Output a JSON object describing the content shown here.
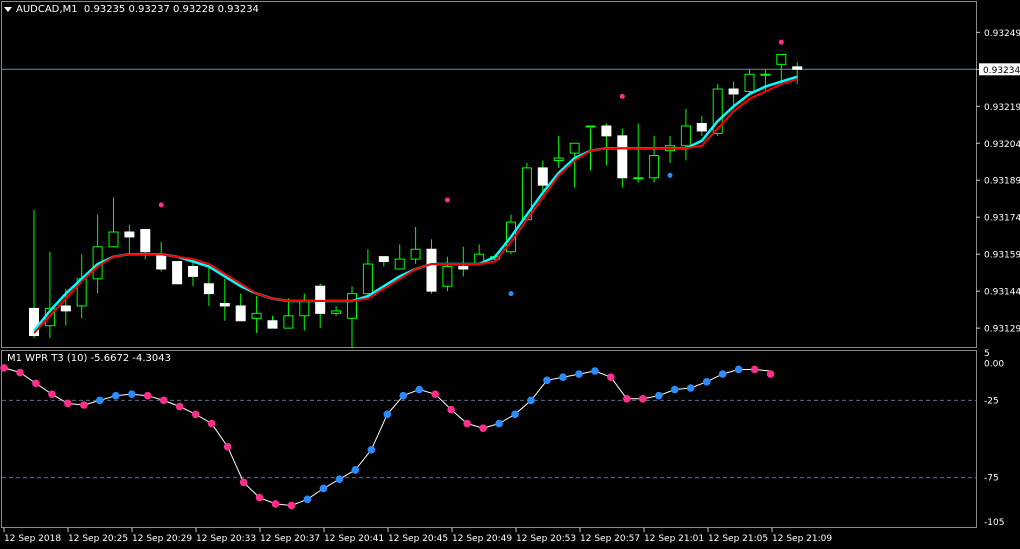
{
  "window": {
    "symbol_timeframe": "AUDCAD,M1",
    "ohlc": [
      "0.93235",
      "0.93237",
      "0.93228",
      "0.93234"
    ]
  },
  "indicator": {
    "label": "M1 WPR T3 (10)",
    "values": [
      "-5.6672",
      "-4.3043"
    ]
  },
  "colors": {
    "background": "#000000",
    "bull_candle": "#00ff00",
    "bear_candle_fill": "#ffffff",
    "ma_red": "#ff0000",
    "ma_cyan": "#00ffff",
    "dot_pink": "#ff2d8c",
    "dot_blue": "#2a8cff",
    "wpr_line": "#ffffff",
    "grid_dashed": "#5a6e8c",
    "bid_line": "#6c8ca0"
  },
  "chart_data": [
    {
      "type": "candlestick",
      "title": "AUDCAD,M1",
      "price_axis_ticks": [
        "0.93249",
        "0.93234",
        "0.93219",
        "0.93204",
        "0.93189",
        "0.93174",
        "0.93159",
        "0.93144",
        "0.93129"
      ],
      "current_price_label": "0.93234",
      "ylim": [
        0.93125,
        0.93254
      ],
      "time_axis_ticks": [
        "12 Sep 2018",
        "12 Sep 20:25",
        "12 Sep 20:29",
        "12 Sep 20:33",
        "12 Sep 20:37",
        "12 Sep 20:41",
        "12 Sep 20:45",
        "12 Sep 20:49",
        "12 Sep 20:53",
        "12 Sep 20:57",
        "12 Sep 21:01",
        "12 Sep 21:05",
        "12 Sep 21:09"
      ],
      "candles": [
        {
          "o": 0.93137,
          "h": 0.93177,
          "l": 0.93125,
          "c": 0.93126
        },
        {
          "o": 0.9313,
          "h": 0.9316,
          "l": 0.93125,
          "c": 0.93137
        },
        {
          "o": 0.93138,
          "h": 0.93145,
          "l": 0.9313,
          "c": 0.93136
        },
        {
          "o": 0.93138,
          "h": 0.93159,
          "l": 0.93133,
          "c": 0.93149
        },
        {
          "o": 0.93149,
          "h": 0.93175,
          "l": 0.93143,
          "c": 0.93162
        },
        {
          "o": 0.93162,
          "h": 0.93182,
          "l": 0.93162,
          "c": 0.93168
        },
        {
          "o": 0.93168,
          "h": 0.93171,
          "l": 0.93159,
          "c": 0.93166
        },
        {
          "o": 0.93169,
          "h": 0.93169,
          "l": 0.93157,
          "c": 0.9316
        },
        {
          "o": 0.93159,
          "h": 0.93164,
          "l": 0.93152,
          "c": 0.93153
        },
        {
          "o": 0.93156,
          "h": 0.93156,
          "l": 0.93147,
          "c": 0.93147
        },
        {
          "o": 0.93154,
          "h": 0.93157,
          "l": 0.93146,
          "c": 0.9315
        },
        {
          "o": 0.93147,
          "h": 0.93154,
          "l": 0.93138,
          "c": 0.93143
        },
        {
          "o": 0.93139,
          "h": 0.93149,
          "l": 0.93132,
          "c": 0.93138
        },
        {
          "o": 0.93138,
          "h": 0.93143,
          "l": 0.93132,
          "c": 0.93132
        },
        {
          "o": 0.93133,
          "h": 0.93142,
          "l": 0.93127,
          "c": 0.93135
        },
        {
          "o": 0.93132,
          "h": 0.93134,
          "l": 0.93129,
          "c": 0.93129
        },
        {
          "o": 0.93129,
          "h": 0.93141,
          "l": 0.93129,
          "c": 0.93134
        },
        {
          "o": 0.93134,
          "h": 0.93143,
          "l": 0.93128,
          "c": 0.9314
        },
        {
          "o": 0.93146,
          "h": 0.93147,
          "l": 0.93129,
          "c": 0.93135
        },
        {
          "o": 0.93135,
          "h": 0.93138,
          "l": 0.93134,
          "c": 0.93136
        },
        {
          "o": 0.93133,
          "h": 0.93146,
          "l": 0.93121,
          "c": 0.93143
        },
        {
          "o": 0.93143,
          "h": 0.93161,
          "l": 0.93141,
          "c": 0.93155
        },
        {
          "o": 0.93158,
          "h": 0.93158,
          "l": 0.93154,
          "c": 0.93156
        },
        {
          "o": 0.93153,
          "h": 0.93163,
          "l": 0.93153,
          "c": 0.93157
        },
        {
          "o": 0.93157,
          "h": 0.9317,
          "l": 0.93155,
          "c": 0.93161
        },
        {
          "o": 0.93161,
          "h": 0.93165,
          "l": 0.93143,
          "c": 0.93144
        },
        {
          "o": 0.93146,
          "h": 0.93158,
          "l": 0.93144,
          "c": 0.93154
        },
        {
          "o": 0.93154,
          "h": 0.93162,
          "l": 0.9315,
          "c": 0.93153
        },
        {
          "o": 0.93155,
          "h": 0.93163,
          "l": 0.93155,
          "c": 0.93159
        },
        {
          "o": 0.93157,
          "h": 0.93159,
          "l": 0.93156,
          "c": 0.93158
        },
        {
          "o": 0.9316,
          "h": 0.93175,
          "l": 0.93159,
          "c": 0.93172
        },
        {
          "o": 0.93173,
          "h": 0.93196,
          "l": 0.93173,
          "c": 0.93194
        },
        {
          "o": 0.93194,
          "h": 0.93197,
          "l": 0.93183,
          "c": 0.93187
        },
        {
          "o": 0.93197,
          "h": 0.93207,
          "l": 0.93194,
          "c": 0.93198
        },
        {
          "o": 0.932,
          "h": 0.93203,
          "l": 0.93186,
          "c": 0.93204
        },
        {
          "o": 0.93211,
          "h": 0.9321,
          "l": 0.93193,
          "c": 0.93211
        },
        {
          "o": 0.93211,
          "h": 0.93212,
          "l": 0.93195,
          "c": 0.93207
        },
        {
          "o": 0.93207,
          "h": 0.9321,
          "l": 0.93186,
          "c": 0.9319
        },
        {
          "o": 0.9319,
          "h": 0.93212,
          "l": 0.93188,
          "c": 0.9319
        },
        {
          "o": 0.9319,
          "h": 0.93207,
          "l": 0.93188,
          "c": 0.93199
        },
        {
          "o": 0.93201,
          "h": 0.93207,
          "l": 0.93196,
          "c": 0.93203
        },
        {
          "o": 0.93203,
          "h": 0.93218,
          "l": 0.93197,
          "c": 0.93211
        },
        {
          "o": 0.93212,
          "h": 0.93215,
          "l": 0.93207,
          "c": 0.93209
        },
        {
          "o": 0.93208,
          "h": 0.93228,
          "l": 0.93207,
          "c": 0.93226
        },
        {
          "o": 0.93226,
          "h": 0.93229,
          "l": 0.93218,
          "c": 0.93224
        },
        {
          "o": 0.93225,
          "h": 0.93234,
          "l": 0.93224,
          "c": 0.93232
        },
        {
          "o": 0.93232,
          "h": 0.93234,
          "l": 0.93225,
          "c": 0.93232
        },
        {
          "o": 0.93236,
          "h": 0.9324,
          "l": 0.93228,
          "c": 0.9324
        },
        {
          "o": 0.93235,
          "h": 0.93237,
          "l": 0.93228,
          "c": 0.93234
        }
      ],
      "ma_red": [
        0.93127,
        0.93134,
        0.93141,
        0.93148,
        0.93154,
        0.93158,
        0.93159,
        0.93159,
        0.93159,
        0.93158,
        0.93157,
        0.93155,
        0.93151,
        0.93147,
        0.93143,
        0.93141,
        0.9314,
        0.9314,
        0.9314,
        0.9314,
        0.9314,
        0.93141,
        0.93145,
        0.93149,
        0.93153,
        0.93155,
        0.93155,
        0.93155,
        0.93155,
        0.93156,
        0.93164,
        0.93173,
        0.93182,
        0.93191,
        0.93197,
        0.93201,
        0.93202,
        0.93202,
        0.93202,
        0.93202,
        0.93202,
        0.93202,
        0.93203,
        0.9321,
        0.93217,
        0.93222,
        0.93225,
        0.93228,
        0.9323
      ],
      "ma_cyan": [
        0.93128,
        0.93136,
        0.93143,
        0.93149,
        0.93155,
        0.93158,
        0.93159,
        0.93159,
        0.93159,
        0.93158,
        0.93156,
        0.93154,
        0.9315,
        0.93146,
        0.93143,
        0.93141,
        0.9314,
        0.9314,
        0.9314,
        0.9314,
        0.9314,
        0.93142,
        0.93146,
        0.9315,
        0.93153,
        0.93155,
        0.93155,
        0.93155,
        0.93155,
        0.93158,
        0.93166,
        0.93175,
        0.93184,
        0.93192,
        0.93198,
        0.93201,
        0.93202,
        0.93202,
        0.93202,
        0.93202,
        0.93202,
        0.93202,
        0.93205,
        0.93213,
        0.93219,
        0.93224,
        0.93227,
        0.93229,
        0.93231
      ],
      "signal_dots": [
        {
          "i": 8,
          "price": 0.93179,
          "color": "pink"
        },
        {
          "i": 26,
          "price": 0.93181,
          "color": "pink"
        },
        {
          "i": 30,
          "price": 0.93143,
          "color": "blue"
        },
        {
          "i": 37,
          "price": 0.93223,
          "color": "pink"
        },
        {
          "i": 40,
          "price": 0.93191,
          "color": "blue"
        },
        {
          "i": 47,
          "price": 0.93245,
          "color": "pink"
        }
      ]
    },
    {
      "type": "line",
      "title": "M1 WPR T3 (10)",
      "yticks": [
        "5",
        "0.00",
        "-25",
        "-75",
        "-105"
      ],
      "levels": [
        -25,
        -75
      ],
      "ylim": [
        -105,
        5
      ],
      "x_index": [
        0,
        1,
        2,
        3,
        4,
        5,
        6,
        7,
        8,
        9,
        10,
        11,
        12,
        13,
        14,
        15,
        16,
        17,
        18,
        19,
        20,
        21,
        22,
        23,
        24,
        25,
        26,
        27,
        28,
        29,
        30,
        31,
        32,
        33,
        34,
        35,
        36,
        37,
        38,
        39,
        40,
        41,
        42,
        43,
        44,
        45,
        46,
        47,
        48
      ],
      "wpr": [
        -4,
        -7,
        -14,
        -21,
        -27,
        -28,
        -25,
        -22,
        -21,
        -22,
        -25,
        -29,
        -34,
        -40,
        -55,
        -78,
        -88,
        -92,
        -93,
        -89,
        -82,
        -76,
        -70,
        -57,
        -34,
        -22,
        -18,
        -21,
        -31,
        -40,
        -43,
        -40,
        -34,
        -25,
        -12,
        -10,
        -8,
        -6,
        -10,
        -24,
        -24,
        -22,
        -18,
        -17,
        -13,
        -8,
        -5,
        -5,
        -6,
        -8
      ],
      "dots": [
        {
          "i": 0,
          "v": -4,
          "color": "pink"
        },
        {
          "i": 1,
          "v": -7,
          "color": "pink"
        },
        {
          "i": 2,
          "v": -14,
          "color": "pink"
        },
        {
          "i": 3,
          "v": -21,
          "color": "pink"
        },
        {
          "i": 4,
          "v": -27,
          "color": "pink"
        },
        {
          "i": 5,
          "v": -28,
          "color": "pink"
        },
        {
          "i": 6,
          "v": -25,
          "color": "blue"
        },
        {
          "i": 7,
          "v": -22,
          "color": "blue"
        },
        {
          "i": 8,
          "v": -21,
          "color": "blue"
        },
        {
          "i": 9,
          "v": -22,
          "color": "pink"
        },
        {
          "i": 10,
          "v": -25,
          "color": "pink"
        },
        {
          "i": 11,
          "v": -29,
          "color": "pink"
        },
        {
          "i": 12,
          "v": -34,
          "color": "pink"
        },
        {
          "i": 13,
          "v": -40,
          "color": "pink"
        },
        {
          "i": 14,
          "v": -55,
          "color": "pink"
        },
        {
          "i": 15,
          "v": -78,
          "color": "pink"
        },
        {
          "i": 16,
          "v": -88,
          "color": "pink"
        },
        {
          "i": 17,
          "v": -92,
          "color": "pink"
        },
        {
          "i": 18,
          "v": -93,
          "color": "pink"
        },
        {
          "i": 19,
          "v": -89,
          "color": "blue"
        },
        {
          "i": 20,
          "v": -82,
          "color": "blue"
        },
        {
          "i": 21,
          "v": -76,
          "color": "blue"
        },
        {
          "i": 22,
          "v": -70,
          "color": "blue"
        },
        {
          "i": 23,
          "v": -57,
          "color": "blue"
        },
        {
          "i": 24,
          "v": -34,
          "color": "blue"
        },
        {
          "i": 25,
          "v": -22,
          "color": "blue"
        },
        {
          "i": 26,
          "v": -18,
          "color": "blue"
        },
        {
          "i": 27,
          "v": -21,
          "color": "pink"
        },
        {
          "i": 28,
          "v": -31,
          "color": "pink"
        },
        {
          "i": 29,
          "v": -40,
          "color": "pink"
        },
        {
          "i": 30,
          "v": -43,
          "color": "pink"
        },
        {
          "i": 31,
          "v": -40,
          "color": "blue"
        },
        {
          "i": 32,
          "v": -34,
          "color": "blue"
        },
        {
          "i": 33,
          "v": -25,
          "color": "blue"
        },
        {
          "i": 34,
          "v": -12,
          "color": "blue"
        },
        {
          "i": 35,
          "v": -10,
          "color": "blue"
        },
        {
          "i": 36,
          "v": -8,
          "color": "blue"
        },
        {
          "i": 37,
          "v": -6,
          "color": "blue"
        },
        {
          "i": 38,
          "v": -10,
          "color": "pink"
        },
        {
          "i": 39,
          "v": -24,
          "color": "pink"
        },
        {
          "i": 40,
          "v": -24,
          "color": "pink"
        },
        {
          "i": 41,
          "v": -22,
          "color": "blue"
        },
        {
          "i": 42,
          "v": -18,
          "color": "blue"
        },
        {
          "i": 43,
          "v": -17,
          "color": "blue"
        },
        {
          "i": 44,
          "v": -13,
          "color": "blue"
        },
        {
          "i": 45,
          "v": -8,
          "color": "blue"
        },
        {
          "i": 46,
          "v": -5,
          "color": "blue"
        },
        {
          "i": 47,
          "v": -5,
          "color": "pink"
        },
        {
          "i": 48,
          "v": -8,
          "color": "pink"
        }
      ]
    }
  ]
}
